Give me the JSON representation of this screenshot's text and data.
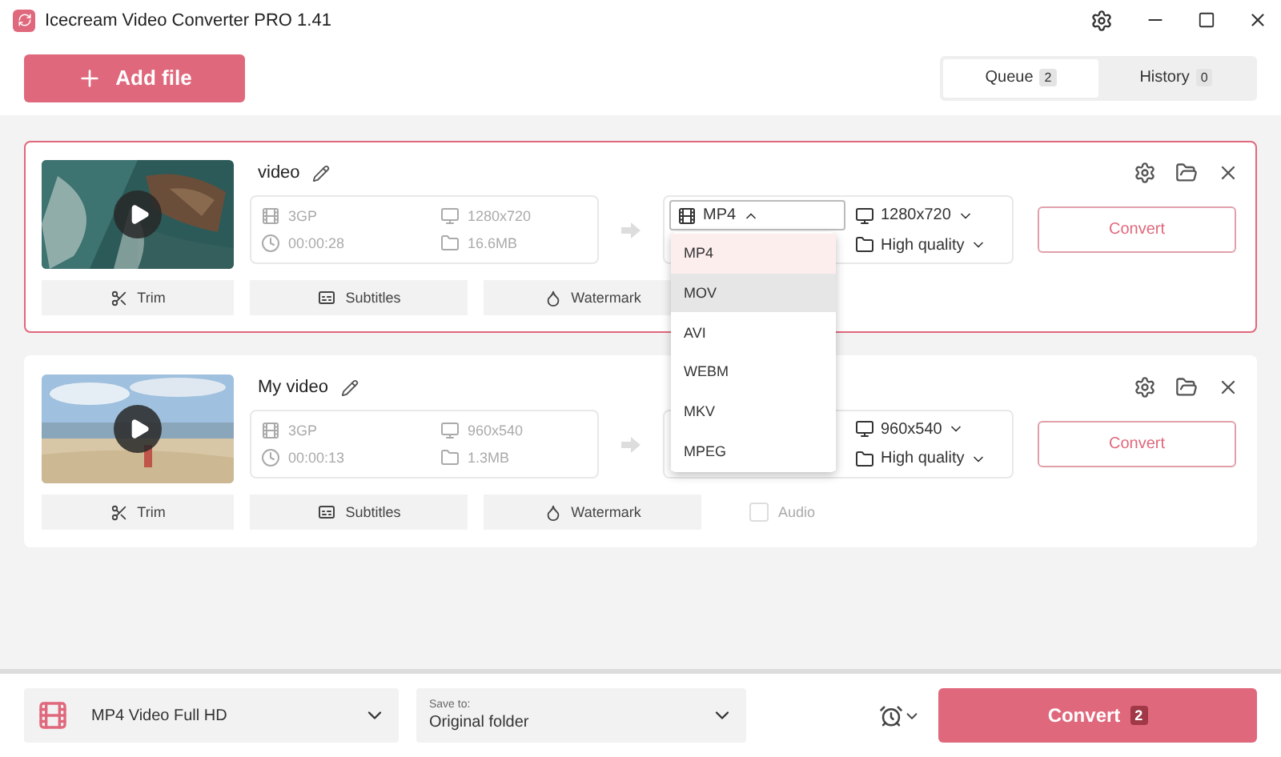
{
  "window": {
    "title": "Icecream Video Converter PRO 1.41"
  },
  "add_file": "Add file",
  "tabs": [
    {
      "label": "Queue",
      "count": "2",
      "selected": true
    },
    {
      "label": "History",
      "count": "0",
      "selected": false
    }
  ],
  "items": [
    {
      "selected": true,
      "name": "video",
      "format": "3GP",
      "resolution": "1280x720",
      "duration": "00:00:28",
      "size": "16.6MB",
      "output_format": "MP4",
      "output_resolution": "1280x720",
      "quality": "High quality",
      "convert": "Convert",
      "trim": "Trim",
      "subtitles": "Subtitles",
      "watermark": "Watermark",
      "format_menu": {
        "open": true,
        "options": [
          {
            "label": "MP4",
            "selected": true,
            "highlighted": false
          },
          {
            "label": "MOV",
            "selected": false,
            "highlighted": true
          },
          {
            "label": "AVI",
            "selected": false,
            "highlighted": false
          },
          {
            "label": "WEBM",
            "selected": false,
            "highlighted": false
          },
          {
            "label": "MKV",
            "selected": false,
            "highlighted": false
          },
          {
            "label": "MPEG",
            "selected": false,
            "highlighted": false
          }
        ]
      }
    },
    {
      "selected": false,
      "name": "My video",
      "format": "3GP",
      "resolution": "960x540",
      "duration": "00:00:13",
      "size": "1.3MB",
      "output_resolution": "960x540",
      "quality": "High quality",
      "convert": "Convert",
      "trim": "Trim",
      "subtitles": "Subtitles",
      "watermark": "Watermark",
      "audio": {
        "label": "Audio",
        "checked": false
      }
    }
  ],
  "footer": {
    "preset": "MP4 Video Full HD",
    "save_to_label": "Save to:",
    "save_to": "Original folder",
    "convert": "Convert",
    "convert_count": "2"
  }
}
